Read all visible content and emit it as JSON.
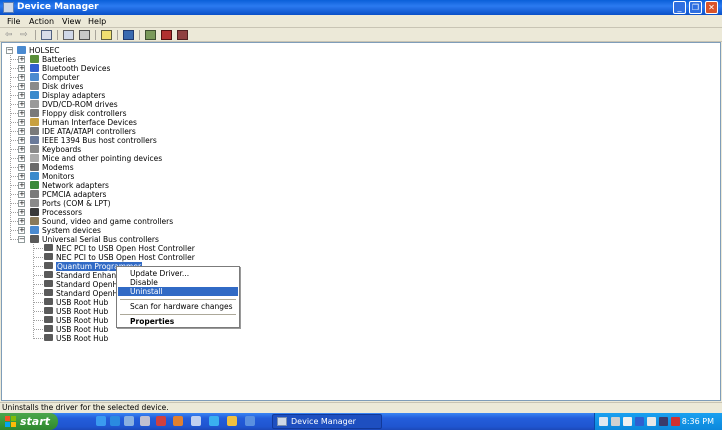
{
  "window": {
    "title": "Device Manager"
  },
  "menu": [
    "File",
    "Action",
    "View",
    "Help"
  ],
  "tree": {
    "root": "HOLSEC",
    "categories": [
      {
        "label": "Batteries",
        "icon": "battery-icon",
        "color": "#5a8f3a"
      },
      {
        "label": "Bluetooth Devices",
        "icon": "bluetooth-icon",
        "color": "#2f5fd0"
      },
      {
        "label": "Computer",
        "icon": "computer-icon",
        "color": "#4a8ad0"
      },
      {
        "label": "Disk drives",
        "icon": "disk-drive-icon",
        "color": "#8a8a8a"
      },
      {
        "label": "Display adapters",
        "icon": "display-adapter-icon",
        "color": "#3a8acc"
      },
      {
        "label": "DVD/CD-ROM drives",
        "icon": "dvd-drive-icon",
        "color": "#9a9a9a"
      },
      {
        "label": "Floppy disk controllers",
        "icon": "floppy-controller-icon",
        "color": "#7a7a7a"
      },
      {
        "label": "Human Interface Devices",
        "icon": "hid-icon",
        "color": "#c8a040"
      },
      {
        "label": "IDE ATA/ATAPI controllers",
        "icon": "ide-controller-icon",
        "color": "#7a7a7a"
      },
      {
        "label": "IEEE 1394 Bus host controllers",
        "icon": "ieee1394-icon",
        "color": "#6a7a9a"
      },
      {
        "label": "Keyboards",
        "icon": "keyboard-icon",
        "color": "#8a8a8a"
      },
      {
        "label": "Mice and other pointing devices",
        "icon": "mouse-icon",
        "color": "#aaaaaa"
      },
      {
        "label": "Modems",
        "icon": "modem-icon",
        "color": "#6a6a6a"
      },
      {
        "label": "Monitors",
        "icon": "monitor-icon",
        "color": "#3a8acc"
      },
      {
        "label": "Network adapters",
        "icon": "network-adapter-icon",
        "color": "#3a8a3a"
      },
      {
        "label": "PCMCIA adapters",
        "icon": "pcmcia-icon",
        "color": "#7a7a7a"
      },
      {
        "label": "Ports (COM & LPT)",
        "icon": "port-icon",
        "color": "#8a8a8a"
      },
      {
        "label": "Processors",
        "icon": "processor-icon",
        "color": "#3a3a3a"
      },
      {
        "label": "Sound, video and game controllers",
        "icon": "sound-icon",
        "color": "#8a7a5a"
      },
      {
        "label": "System devices",
        "icon": "system-devices-icon",
        "color": "#4a8ad0"
      },
      {
        "label": "Universal Serial Bus controllers",
        "icon": "usb-icon",
        "color": "#5a5a5a"
      }
    ],
    "usb_children": [
      "NEC PCI to USB Open Host Controller",
      "NEC PCI to USB Open Host Controller",
      "Quantum Programmer",
      "Standard Enhance",
      "Standard OpenHC",
      "Standard OpenHC",
      "USB Root Hub",
      "USB Root Hub",
      "USB Root Hub",
      "USB Root Hub",
      "USB Root Hub"
    ],
    "selected": "Quantum Programmer"
  },
  "context_menu": {
    "items": [
      {
        "label": "Update Driver..."
      },
      {
        "label": "Disable"
      },
      {
        "label": "Uninstall"
      },
      {
        "label": "Scan for hardware changes"
      },
      {
        "label": "Properties"
      }
    ],
    "highlighted": "Uninstall"
  },
  "status": {
    "text": "Uninstalls the driver for the selected device."
  },
  "taskbar": {
    "start_label": "start",
    "task_label": "Device Manager",
    "clock": "8:36 PM"
  },
  "colors": {
    "selection": "#316ac5",
    "title_blue": "#0a5fd8",
    "start_green": "#3c9a3c"
  }
}
